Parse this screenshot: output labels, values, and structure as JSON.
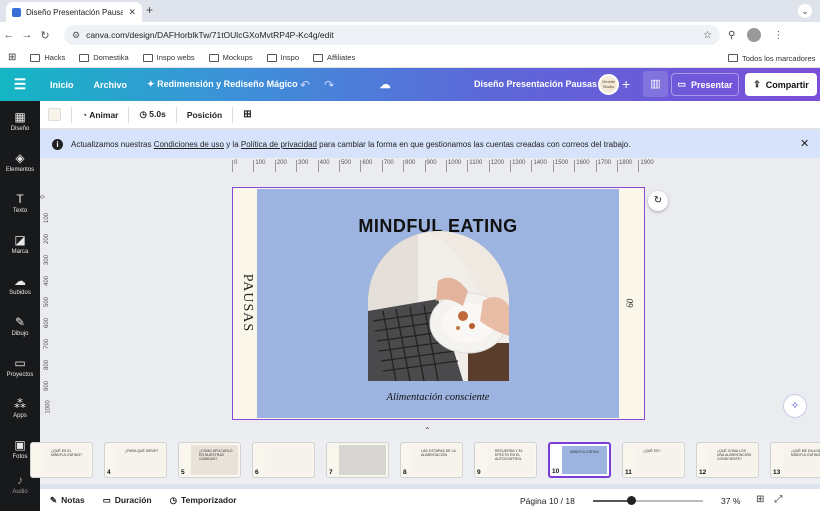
{
  "browser": {
    "tab_title": "Diseño Presentación Pausas",
    "url": "canva.com/design/DAFHorblkTw/71tOUlcGXoMvtRP4P-Kc4g/edit",
    "bookmarks": [
      "Hacks",
      "Domestika",
      "Inspo webs",
      "Mockups",
      "Inspo",
      "Affiliates"
    ],
    "bookmarks_right": "Todos los marcadores"
  },
  "topbar": {
    "menu": [
      "Inicio",
      "Archivo",
      "Redimensión y Rediseño Mágico"
    ],
    "doc_title": "Diseño Presentación Pausas",
    "avatar_text": "Omelle Studio",
    "present": "Presentar",
    "share": "Compartir",
    "gradient": [
      "#14b6c4",
      "#5d67d8",
      "#7b4fd9"
    ]
  },
  "sidebar": [
    "Diseño",
    "Elementos",
    "Texto",
    "Marca",
    "Subidos",
    "Dibujo",
    "Proyectos",
    "Apps",
    "Fotos",
    "Audio"
  ],
  "edit_toolbar": {
    "animate": "Animar",
    "duration": "5.0s",
    "position": "Posición"
  },
  "notice": {
    "pre": "Actualizamos nuestras ",
    "link1": "Condiciones de uso",
    "mid": " y la ",
    "link2": "Política de privacidad",
    "post": " para cambiar la forma en que gestionamos las cuentas creadas con correos del trabajo."
  },
  "ruler": {
    "h": [
      "0",
      "100",
      "200",
      "300",
      "400",
      "500",
      "600",
      "700",
      "800",
      "900",
      "1000",
      "1100",
      "1200",
      "1300",
      "1400",
      "1500",
      "1600",
      "1700",
      "1800",
      "1900"
    ],
    "v": [
      "0",
      "100",
      "200",
      "300",
      "400",
      "500",
      "600",
      "700",
      "800",
      "900",
      "1000"
    ]
  },
  "slide": {
    "title": "MINDFUL EATING",
    "subtitle": "Alimentación consciente",
    "side_text": "PAUSAS",
    "page_number": "09",
    "bg_color": "#9cb4df"
  },
  "thumbnails": [
    {
      "n": "",
      "text": "¿QUÉ ES EL MINDFUL EATING?"
    },
    {
      "n": "4",
      "text": "¿PARA QUÉ SIRVE?"
    },
    {
      "n": "5",
      "text": "¿CÓMO APLICARLO EN NUESTRAS COMIDAS?"
    },
    {
      "n": "6",
      "text": ""
    },
    {
      "n": "7",
      "text": ""
    },
    {
      "n": "8",
      "text": "LAS 5 ETAPAS DE LA ALIMENTACIÓN"
    },
    {
      "n": "9",
      "text": "RECUERDA Y EL EFECTO EN EL AUTOCONTROL"
    },
    {
      "n": "10",
      "text": "MINDFUL EATING"
    },
    {
      "n": "11",
      "text": "¿QUÉ ES?"
    },
    {
      "n": "12",
      "text": "¿QUÉ COMA LOS UNA ALIMENTACIÓN CONSCIENTE?"
    },
    {
      "n": "13",
      "text": "¿QUÉ ME DA A DE MINDFUL EATING?"
    }
  ],
  "bottom": {
    "notes": "Notas",
    "duration": "Duración",
    "timer": "Temporizador",
    "page": "Página 10 / 18",
    "zoom": "37 %",
    "zoom_fraction": 0.37
  }
}
